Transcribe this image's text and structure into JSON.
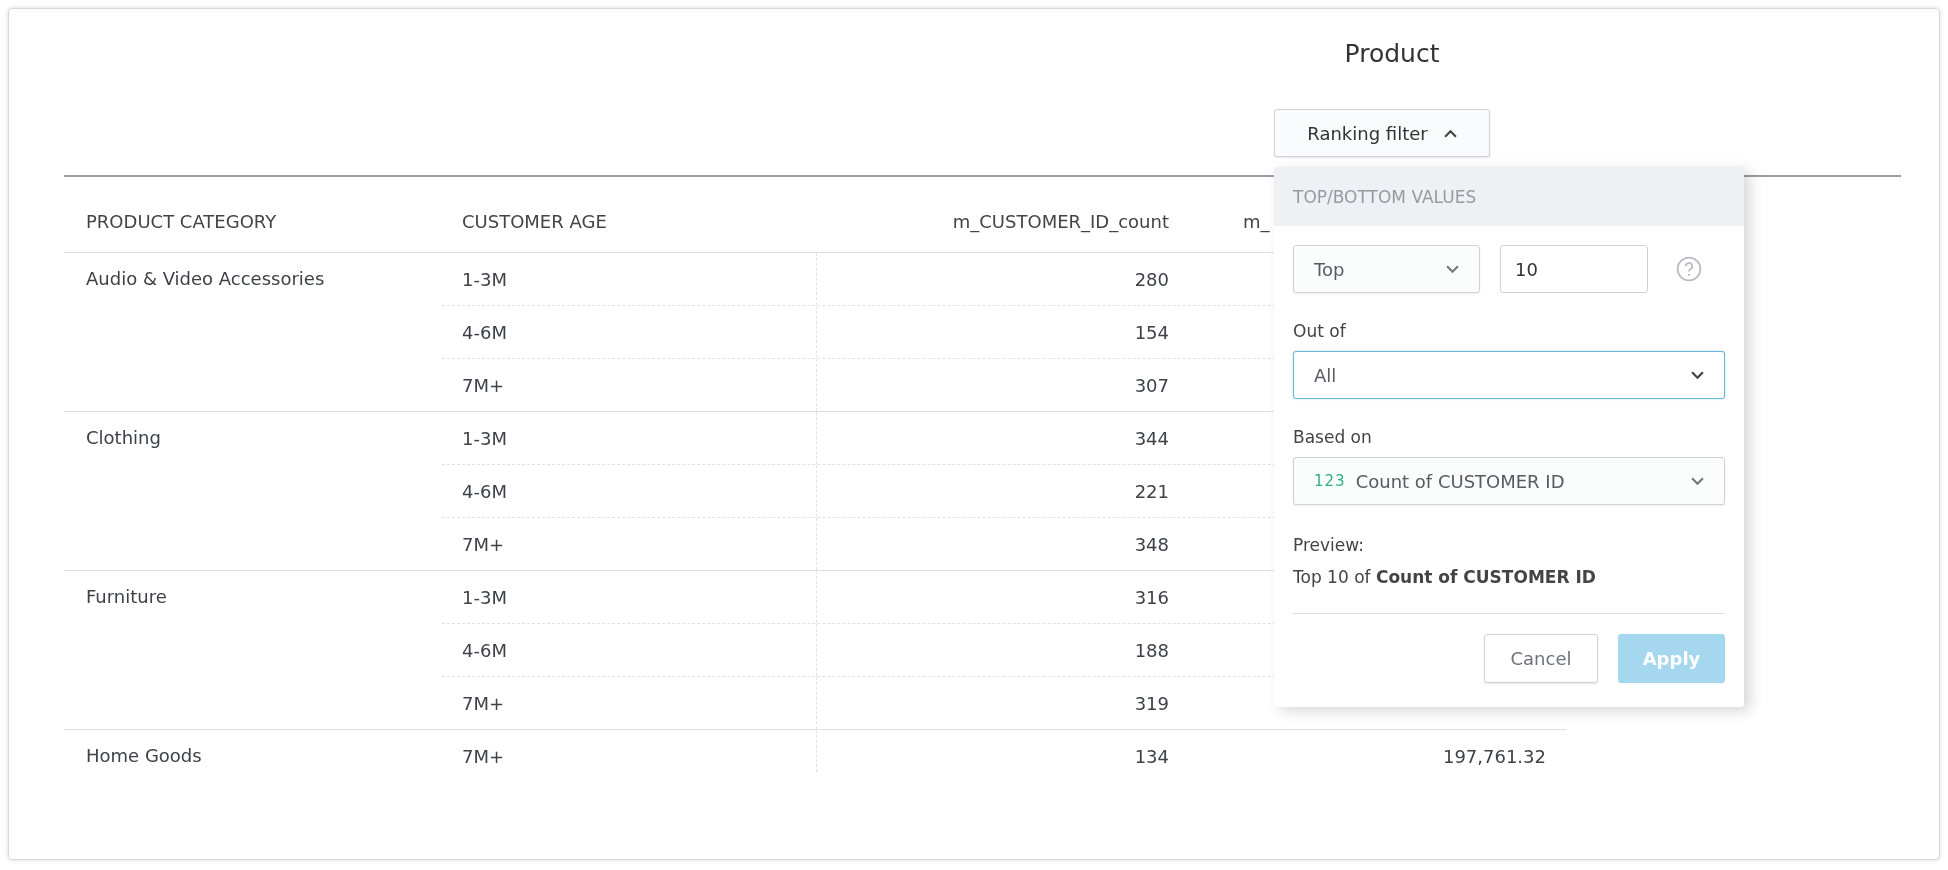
{
  "title": "Product",
  "ranking_button": {
    "label": "Ranking filter",
    "expanded": true
  },
  "table": {
    "columns": [
      "PRODUCT CATEGORY",
      "CUSTOMER AGE",
      "m_CUSTOMER_ID_count",
      "m_"
    ],
    "groups": [
      {
        "category": "Audio & Video Accessories",
        "rows": [
          {
            "age": "1-3M",
            "count": "280"
          },
          {
            "age": "4-6M",
            "count": "154"
          },
          {
            "age": "7M+",
            "count": "307"
          }
        ]
      },
      {
        "category": "Clothing",
        "rows": [
          {
            "age": "1-3M",
            "count": "344"
          },
          {
            "age": "4-6M",
            "count": "221"
          },
          {
            "age": "7M+",
            "count": "348"
          }
        ]
      },
      {
        "category": "Furniture",
        "rows": [
          {
            "age": "1-3M",
            "count": "316"
          },
          {
            "age": "4-6M",
            "count": "188"
          },
          {
            "age": "7M+",
            "count": "319"
          }
        ]
      },
      {
        "category": "Home Goods",
        "rows": [
          {
            "age": "7M+",
            "count": "134",
            "column_4": "197,761.32"
          }
        ]
      }
    ]
  },
  "popup": {
    "header": "TOP/BOTTOM VALUES",
    "direction_select": {
      "value": "Top"
    },
    "count_input": {
      "value": "10"
    },
    "out_of": {
      "label": "Out of",
      "value": "All",
      "focused": true
    },
    "based_on": {
      "label": "Based on",
      "type_badge": "123",
      "value": "Count of CUSTOMER ID"
    },
    "preview_label": "Preview:",
    "preview_text": "Top 10 of **Count of CUSTOMER ID**",
    "buttons": [
      {
        "label": "Cancel",
        "kind": "secondary",
        "disabled": false
      },
      {
        "label": "Apply",
        "kind": "primary",
        "disabled": true
      }
    ]
  }
}
